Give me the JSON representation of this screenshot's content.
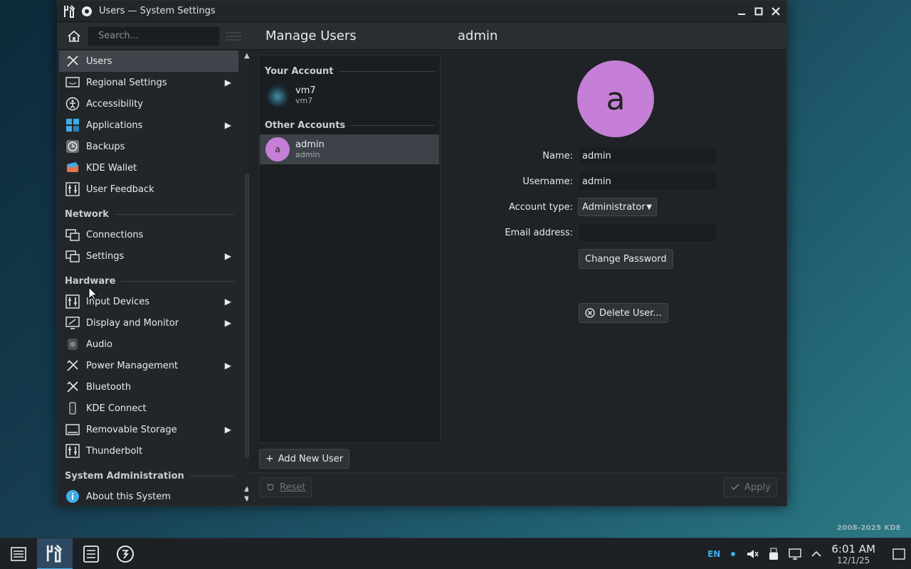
{
  "window": {
    "title": "Users — System Settings",
    "search_placeholder": "Search...",
    "page_title": "Manage Users",
    "page_subtitle": "admin"
  },
  "sidebar": {
    "items": [
      {
        "label": "Users",
        "icon": "users-icon",
        "chevron": false,
        "active": true
      },
      {
        "label": "Regional Settings",
        "icon": "regional-icon",
        "chevron": true
      },
      {
        "label": "Accessibility",
        "icon": "accessibility-icon",
        "chevron": false
      },
      {
        "label": "Applications",
        "icon": "applications-icon",
        "chevron": true
      },
      {
        "label": "Backups",
        "icon": "backups-icon",
        "chevron": false
      },
      {
        "label": "KDE Wallet",
        "icon": "wallet-icon",
        "chevron": false
      },
      {
        "label": "User Feedback",
        "icon": "feedback-icon",
        "chevron": false
      },
      {
        "label": "Connections",
        "icon": "connections-icon",
        "chevron": false
      },
      {
        "label": "Settings",
        "icon": "network-settings-icon",
        "chevron": true
      },
      {
        "label": "Input Devices",
        "icon": "input-devices-icon",
        "chevron": true
      },
      {
        "label": "Display and Monitor",
        "icon": "display-icon",
        "chevron": true
      },
      {
        "label": "Audio",
        "icon": "audio-icon",
        "chevron": false
      },
      {
        "label": "Power Management",
        "icon": "power-icon",
        "chevron": true
      },
      {
        "label": "Bluetooth",
        "icon": "bluetooth-icon",
        "chevron": false
      },
      {
        "label": "KDE Connect",
        "icon": "kde-connect-icon",
        "chevron": false
      },
      {
        "label": "Removable Storage",
        "icon": "removable-storage-icon",
        "chevron": true
      },
      {
        "label": "Thunderbolt",
        "icon": "thunderbolt-icon",
        "chevron": false
      },
      {
        "label": "About this System",
        "icon": "info-icon",
        "chevron": false
      }
    ],
    "sections": {
      "network": "Network",
      "hardware": "Hardware",
      "sysadmin": "System Administration"
    }
  },
  "users_list": {
    "your_account_header": "Your Account",
    "other_accounts_header": "Other Accounts",
    "your_account": {
      "name": "vm7",
      "username": "vm7"
    },
    "other_accounts": [
      {
        "name": "admin",
        "username": "admin",
        "initial": "a"
      }
    ],
    "add_button": "Add New User"
  },
  "details": {
    "avatar_initial": "a",
    "avatar_color": "#c57fd6",
    "name_label": "Name:",
    "name_value": "admin",
    "username_label": "Username:",
    "username_value": "admin",
    "account_type_label": "Account type:",
    "account_type_value": "Administrator",
    "email_label": "Email address:",
    "email_value": "",
    "change_password": "Change Password",
    "delete_user": "Delete User..."
  },
  "footer": {
    "reset": "Reset",
    "apply": "Apply"
  },
  "desktop": {
    "credit": "2008-2025 KDE"
  },
  "taskbar": {
    "lang": "EN",
    "time": "6:01 AM",
    "date": "12/1/25"
  },
  "colors": {
    "accent": "#3daee9",
    "selection": "#40454b",
    "avatar": "#c57fd6"
  }
}
